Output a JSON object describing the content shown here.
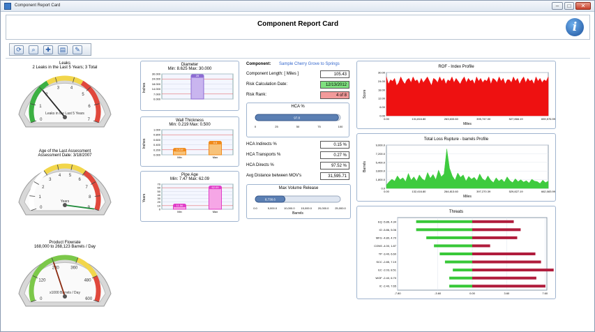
{
  "window": {
    "title": "Component Report Card",
    "minimize": "–",
    "maximize": "□",
    "close": "✕"
  },
  "page": {
    "title": "Component Report Card",
    "logo": "i"
  },
  "toolbar": {
    "buttons": [
      "refresh-icon",
      "zoom-icon",
      "add-icon",
      "notes-icon",
      "edit-icon"
    ]
  },
  "leaks": {
    "title": "Leaks",
    "subtitle": "2 Leaks in the Last 5 Years;  3 Total",
    "gauge_label": "Leaks in the Last 5 Years",
    "ticks": [
      "0",
      "1",
      "2",
      "3",
      "4",
      "5",
      "6",
      "7"
    ],
    "value": 2
  },
  "age": {
    "title": "Age of the Last Assessment",
    "subtitle": "Assessment Date: 3/18/2007",
    "gauge_label": "Years",
    "ticks": [
      "0",
      "1",
      "2",
      "3",
      "4",
      "5",
      "6",
      "7",
      "8",
      "9"
    ],
    "value": 9
  },
  "flow": {
    "title": "Product Flowrate",
    "subtitle": "168,000  to  268,123  Barrels / Day",
    "gauge_label": "x1000 Barrels / Day",
    "ticks": [
      "0",
      "120",
      "240",
      "360",
      "480",
      "600"
    ],
    "value": 240
  },
  "diameter": {
    "title": "Diameter",
    "subtitle": "Min: 8.625   Max: 30.000",
    "ylabel": "Inches",
    "yticks": [
      "30.000",
      "24.000",
      "18.000",
      "14.000",
      "7.000",
      "0.000"
    ],
    "bar_label": "28",
    "value": 28
  },
  "wall": {
    "title": "Wall Thickness",
    "subtitle": "Min: 0.219   Max: 0.500",
    "ylabel": "Inches",
    "yticks": [
      "1.000",
      "0.800",
      "0.600",
      "0.400",
      "0.200",
      "0.000"
    ],
    "categories": [
      "Min",
      "Max"
    ],
    "bar_labels": [
      "0.219",
      "0.5"
    ],
    "values": [
      0.219,
      0.5
    ]
  },
  "pipeage": {
    "title": "Pipe Age",
    "subtitle": "Min: 7.47   Max: 62.09",
    "ylabel": "Years",
    "yticks": [
      "70",
      "60",
      "50",
      "40",
      "30",
      "20",
      "10",
      "0"
    ],
    "categories": [
      "Min",
      "Max"
    ],
    "bar_labels": [
      "11.56",
      "62.09"
    ],
    "values": [
      11.56,
      62.09
    ]
  },
  "component": {
    "label": "Component:",
    "value": "Sample Cherry Grove to Springs",
    "fields": [
      {
        "label": "Component Length:  [ Miles ]",
        "value": "105.43",
        "bg": "#ffffff"
      },
      {
        "label": "Risk Calculation Date:",
        "value": "12/13/2012",
        "bg": "#7fe07f"
      },
      {
        "label": "Risk Rank:",
        "value": "4 of 8",
        "bg": "#f29a9a"
      }
    ]
  },
  "hca": {
    "title": "HCA %",
    "value_label": "97.8",
    "value": 97.8,
    "ticks": [
      "0",
      "25",
      "50",
      "75",
      "100"
    ]
  },
  "hca_fields": [
    {
      "label": "HCA Indirects %",
      "value": "0.15 %"
    },
    {
      "label": "HCA Transports %",
      "value": "0.27 %"
    },
    {
      "label": "HCA Directs %",
      "value": "97.52 %"
    },
    {
      "label": "Avg Distance between MOV's",
      "value": "31,595.71"
    }
  ],
  "maxvol": {
    "title": "Max Volume Release",
    "value_label": "8,738.6",
    "value": 8738.6,
    "ticks": [
      "0.0",
      "5,000.0",
      "10,000.0",
      "15,000.0",
      "20,000.0",
      "25,000.0"
    ],
    "xlabel": "Barrels"
  },
  "colors": {
    "accent": "#3366cc",
    "gauge_green": "#33aa33",
    "gauge_red": "#dd3333",
    "chart_red": "#ee1111",
    "chart_green": "#3ecb3e",
    "threat_red": "#b01c3c",
    "threat_green": "#38c838"
  },
  "chart_data": [
    {
      "type": "area",
      "title": "ROF - Index  Profile",
      "xlabel": "Miles",
      "ylabel": "Score",
      "yticks": [
        "30.00",
        "24.00",
        "18.00",
        "12.00",
        "6.00",
        "0.00"
      ],
      "xticks": [
        "0.00",
        "131,816.80",
        "263,633.60",
        "395,747.00",
        "527,866.19",
        "659,576.99"
      ],
      "ylim": [
        0,
        30
      ],
      "xlim": [
        0,
        659576.99
      ],
      "profile": [
        27,
        22,
        25,
        24,
        26,
        21,
        23,
        27,
        24,
        22,
        25,
        26,
        23,
        27,
        24,
        25,
        22,
        26,
        23,
        25,
        27,
        24,
        21,
        26,
        25,
        23,
        27,
        24,
        26,
        22,
        25,
        24,
        27,
        23,
        26,
        24,
        22,
        25,
        27,
        23,
        26,
        24,
        25,
        22,
        27,
        24,
        26,
        23,
        25,
        24,
        27,
        22,
        26,
        25,
        23,
        27,
        24,
        26,
        22,
        25,
        25,
        23,
        27,
        24,
        26,
        22,
        25,
        27,
        23,
        26,
        24,
        25,
        22,
        27,
        24,
        26,
        23,
        25,
        24,
        27
      ]
    },
    {
      "type": "area",
      "title": "Total Loss Rupture - barrels  Profile",
      "xlabel": "Miles",
      "ylabel": "Barrels",
      "yticks": [
        "9,000.0",
        "7,200.0",
        "5,400.0",
        "3,600.0",
        "1,800.0",
        "0.0"
      ],
      "xticks": [
        "0.00",
        "132,416.80",
        "264,813.60",
        "397,270.39",
        "529,827.19",
        "662,083.99"
      ],
      "ylim": [
        0,
        9000
      ],
      "xlim": [
        0,
        662083.99
      ],
      "profile": [
        700,
        1400,
        1900,
        1500,
        2600,
        1800,
        2200,
        1400,
        3100,
        1700,
        2400,
        1500,
        2800,
        2000,
        1600,
        3300,
        2100,
        2900,
        1800,
        3800,
        2400,
        3000,
        8200,
        4200,
        2600,
        1700,
        3200,
        2300,
        2800,
        1500,
        2500,
        1900,
        2300,
        1600,
        3000,
        2000,
        1600,
        2600,
        1700,
        1200,
        2200,
        1500,
        1900,
        1300,
        2400,
        1600,
        1200,
        2000,
        1400,
        1800,
        1300,
        1600,
        1100,
        1900,
        1500,
        1400,
        1000,
        1700,
        1200,
        1500
      ]
    },
    {
      "type": "bar",
      "title": "Threats",
      "categories": [
        "EQ",
        "IO",
        "MFG",
        "CONS",
        "TP",
        "SCC",
        "EC",
        "WOF",
        "IC"
      ],
      "labels": [
        "EQ  -5.86, 4.34",
        "IO  -5.86, 5.06",
        "MFG  -4.80, 4.70",
        "CONS  -4.00, 1.87",
        "TP  -3.40, 6.60",
        "SCC  -2.85, 7.19",
        "EC  -2.03, 8.51",
        "WOF  -2.40, 6.70",
        "IC  -2.40, 7.65"
      ],
      "negative": [
        -5.86,
        -5.86,
        -4.8,
        -4.0,
        -3.4,
        -2.85,
        -2.03,
        -2.4,
        -2.4
      ],
      "positive": [
        4.34,
        5.06,
        4.7,
        1.87,
        6.6,
        7.19,
        8.51,
        6.7,
        7.65
      ],
      "xticks": [
        "-7.80",
        "-3.60",
        "0.00",
        "3.60",
        "7.60"
      ],
      "xlim": [
        -7.8,
        7.8
      ]
    }
  ]
}
